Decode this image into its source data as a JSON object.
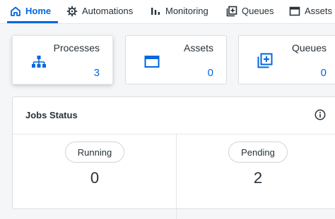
{
  "nav": {
    "tabs": [
      {
        "label": "Home",
        "icon": "home-icon",
        "active": true
      },
      {
        "label": "Automations",
        "icon": "automations-gear-icon",
        "active": false
      },
      {
        "label": "Monitoring",
        "icon": "bar-chart-icon",
        "active": false
      },
      {
        "label": "Queues",
        "icon": "queue-plus-icon",
        "active": false
      },
      {
        "label": "Assets",
        "icon": "asset-window-icon",
        "active": false
      }
    ]
  },
  "cards": [
    {
      "title": "Processes",
      "count": "3",
      "icon": "process-tree-icon"
    },
    {
      "title": "Assets",
      "count": "0",
      "icon": "asset-window-icon"
    },
    {
      "title": "Queues",
      "count": "0",
      "icon": "queue-plus-icon"
    }
  ],
  "jobs_status": {
    "title": "Jobs Status",
    "info_icon": "info-icon",
    "stats": [
      {
        "label": "Running",
        "value": "0"
      },
      {
        "label": "Pending",
        "value": "2"
      }
    ]
  },
  "colors": {
    "accent": "#0067df",
    "text": "#273139",
    "background": "#f5f6f7",
    "border": "#d9dde1"
  }
}
